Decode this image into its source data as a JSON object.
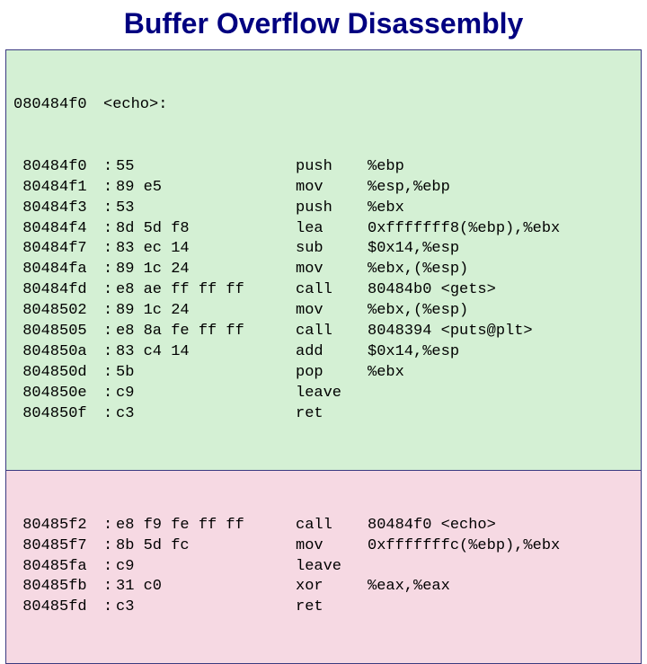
{
  "title": "Buffer Overflow Disassembly",
  "block1": {
    "header": {
      "addr": "080484f0",
      "label": "<echo>:"
    },
    "rows": [
      {
        "addr": "80484f0",
        "bytes": "55",
        "mnem": "push",
        "ops": "%ebp"
      },
      {
        "addr": "80484f1",
        "bytes": "89 e5",
        "mnem": "mov",
        "ops": "%esp,%ebp"
      },
      {
        "addr": "80484f3",
        "bytes": "53",
        "mnem": "push",
        "ops": "%ebx"
      },
      {
        "addr": "80484f4",
        "bytes": "8d 5d f8",
        "mnem": "lea",
        "ops": "0xfffffff8(%ebp),%ebx"
      },
      {
        "addr": "80484f7",
        "bytes": "83 ec 14",
        "mnem": "sub",
        "ops": "$0x14,%esp"
      },
      {
        "addr": "80484fa",
        "bytes": "89 1c 24",
        "mnem": "mov",
        "ops": "%ebx,(%esp)"
      },
      {
        "addr": "80484fd",
        "bytes": "e8 ae ff ff ff",
        "mnem": "call",
        "ops": "80484b0 <gets>"
      },
      {
        "addr": "8048502",
        "bytes": "89 1c 24",
        "mnem": "mov",
        "ops": "%ebx,(%esp)"
      },
      {
        "addr": "8048505",
        "bytes": "e8 8a fe ff ff",
        "mnem": "call",
        "ops": "8048394 <puts@plt>"
      },
      {
        "addr": "804850a",
        "bytes": "83 c4 14",
        "mnem": "add",
        "ops": "$0x14,%esp"
      },
      {
        "addr": "804850d",
        "bytes": "5b",
        "mnem": "pop",
        "ops": "%ebx"
      },
      {
        "addr": "804850e",
        "bytes": "c9",
        "mnem": "leave",
        "ops": ""
      },
      {
        "addr": "804850f",
        "bytes": "c3",
        "mnem": "ret",
        "ops": ""
      }
    ]
  },
  "block2": {
    "rows": [
      {
        "addr": "80485f2",
        "bytes": "e8 f9 fe ff ff",
        "mnem": "call",
        "ops": "80484f0 <echo>"
      },
      {
        "addr": "80485f7",
        "bytes": "8b 5d fc",
        "mnem": "mov",
        "ops": "0xfffffffc(%ebp),%ebx"
      },
      {
        "addr": "80485fa",
        "bytes": "c9",
        "mnem": "leave",
        "ops": ""
      },
      {
        "addr": "80485fb",
        "bytes": "31 c0",
        "mnem": "xor",
        "ops": "%eax,%eax"
      },
      {
        "addr": "80485fd",
        "bytes": "c3",
        "mnem": "ret",
        "ops": ""
      }
    ]
  }
}
